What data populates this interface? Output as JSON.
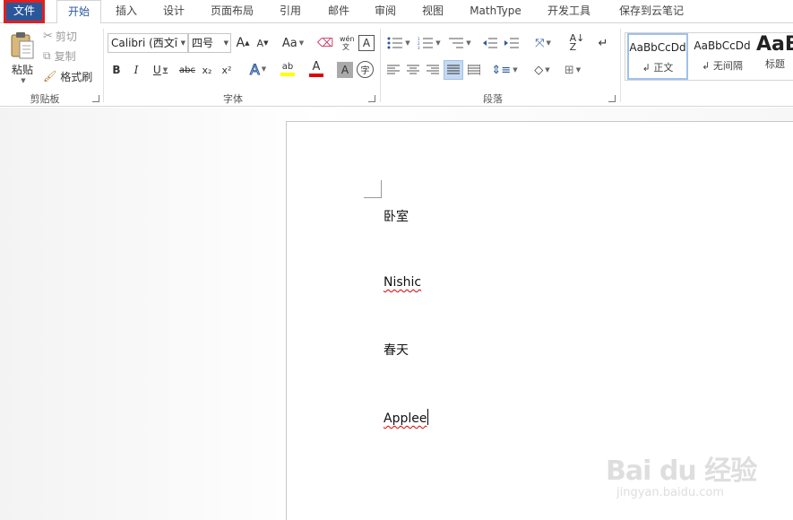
{
  "tabs": [
    {
      "label": "文件"
    },
    {
      "label": "开始"
    },
    {
      "label": "插入"
    },
    {
      "label": "设计"
    },
    {
      "label": "页面布局"
    },
    {
      "label": "引用"
    },
    {
      "label": "邮件"
    },
    {
      "label": "审阅"
    },
    {
      "label": "视图"
    },
    {
      "label": "MathType"
    },
    {
      "label": "开发工具"
    },
    {
      "label": "保存到云笔记"
    }
  ],
  "ribbon": {
    "clipboard": {
      "paste_label": "粘贴",
      "cut_label": "剪切",
      "copy_label": "复制",
      "format_painter_label": "格式刷",
      "group_label": "剪贴板"
    },
    "font": {
      "font_name": "Calibri (西文ī",
      "font_size": "四号",
      "grow_glyph": "A",
      "shrink_glyph": "A",
      "change_case_glyph": "Aa",
      "phonetic_glyph": "wén 文",
      "border_glyph": "A",
      "bold": "B",
      "italic": "I",
      "underline": "U",
      "strike": "abc",
      "subscript": "x₂",
      "superscript": "x²",
      "effects_glyph": "A",
      "highlight_glyph": "ab",
      "font_color_glyph": "A",
      "shading_glyph": "A",
      "enclose_glyph": "字",
      "group_label": "字体"
    },
    "paragraph": {
      "group_label": "段落"
    },
    "styles": [
      {
        "sample": "AaBbCcDd",
        "name": "↲ 正文"
      },
      {
        "sample": "AaBbCcDd",
        "name": "↲ 无间隔"
      },
      {
        "sample": "AaB",
        "name": "标题"
      }
    ]
  },
  "document": {
    "paragraphs": [
      "卧室",
      "Nishic",
      "春天",
      "Applee"
    ]
  },
  "watermark": {
    "main": "Bai du 经验",
    "sub": "jingyan.baidu.com"
  },
  "colors": {
    "file_tab": "#2b579a",
    "highlight": "#e02020",
    "highlight_yellow": "#ffff00",
    "font_red": "#e00000"
  }
}
